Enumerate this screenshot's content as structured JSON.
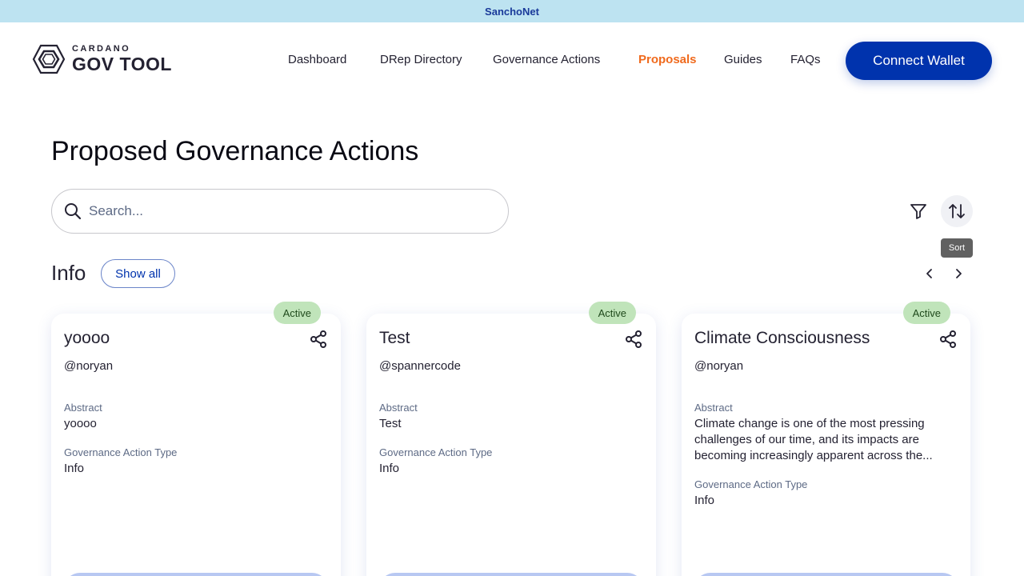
{
  "banner": {
    "network": "SanchoNet"
  },
  "logo": {
    "small": "CARDANO",
    "big": "GOV TOOL"
  },
  "nav": {
    "items": [
      {
        "label": "Dashboard",
        "active": false
      },
      {
        "label": "DRep Directory",
        "active": false
      },
      {
        "label": "Governance Actions",
        "active": false
      },
      {
        "label": "Proposals",
        "active": true
      },
      {
        "label": "Guides",
        "active": false
      },
      {
        "label": "FAQs",
        "active": false
      }
    ],
    "connect_label": "Connect Wallet"
  },
  "main": {
    "title": "Proposed Governance Actions",
    "search": {
      "placeholder": "Search...",
      "value": ""
    },
    "sort_tooltip": "Sort",
    "section": {
      "title": "Info",
      "show_all_label": "Show all"
    },
    "cards": [
      {
        "status": "Active",
        "title": "yoooo",
        "author": "@noryan",
        "abstract_label": "Abstract",
        "abstract": "yoooo",
        "type_label": "Governance Action Type",
        "type": "Info"
      },
      {
        "status": "Active",
        "title": "Test",
        "author": "@spannercode",
        "abstract_label": "Abstract",
        "abstract": "Test",
        "type_label": "Governance Action Type",
        "type": "Info"
      },
      {
        "status": "Active",
        "title": "Climate Consciousness",
        "author": "@noryan",
        "abstract_label": "Abstract",
        "abstract": "Climate change is one of the most pressing challenges of our time, and its impacts are becoming increasingly apparent across the...",
        "type_label": "Governance Action Type",
        "type": "Info"
      }
    ]
  },
  "icons": {
    "search": "search-icon",
    "filter": "filter-icon",
    "sort": "sort-arrows-icon",
    "prev": "chevron-left-icon",
    "next": "chevron-right-icon",
    "share": "share-icon"
  },
  "colors": {
    "banner_bg": "#bde3f1",
    "primary": "#0033ad",
    "active_nav": "#f06a1d",
    "badge_bg": "#c0e4ba"
  }
}
